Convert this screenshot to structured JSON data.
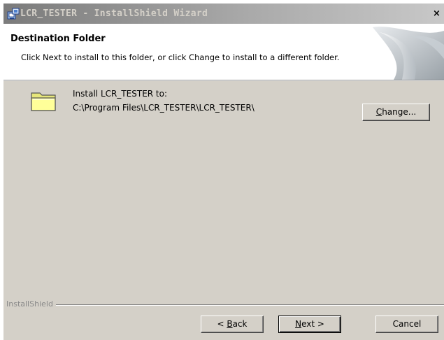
{
  "window": {
    "title": "LCR_TESTER - InstallShield Wizard",
    "close_label": "×"
  },
  "header": {
    "title": "Destination Folder",
    "description": "Click Next to install to this folder, or click Change to install to a different folder."
  },
  "content": {
    "install_label": "Install LCR_TESTER to:",
    "install_path": "C:\\Program Files\\LCR_TESTER\\LCR_TESTER\\"
  },
  "buttons": {
    "change": {
      "mnemonic": "C",
      "rest": "hange..."
    },
    "back": {
      "prefix": "< ",
      "mnemonic": "B",
      "rest": "ack"
    },
    "next": {
      "mnemonic": "N",
      "rest": "ext >"
    },
    "cancel": "Cancel"
  },
  "footer": {
    "brand": "InstallShield"
  },
  "colors": {
    "dialog_bg": "#d4d0c8",
    "header_bg": "#ffffff",
    "folder_yellow": "#ffff99"
  },
  "icons": {
    "app": "installer-icon",
    "folder": "folder-icon",
    "header_art": "abstract-swoosh-graphic"
  }
}
